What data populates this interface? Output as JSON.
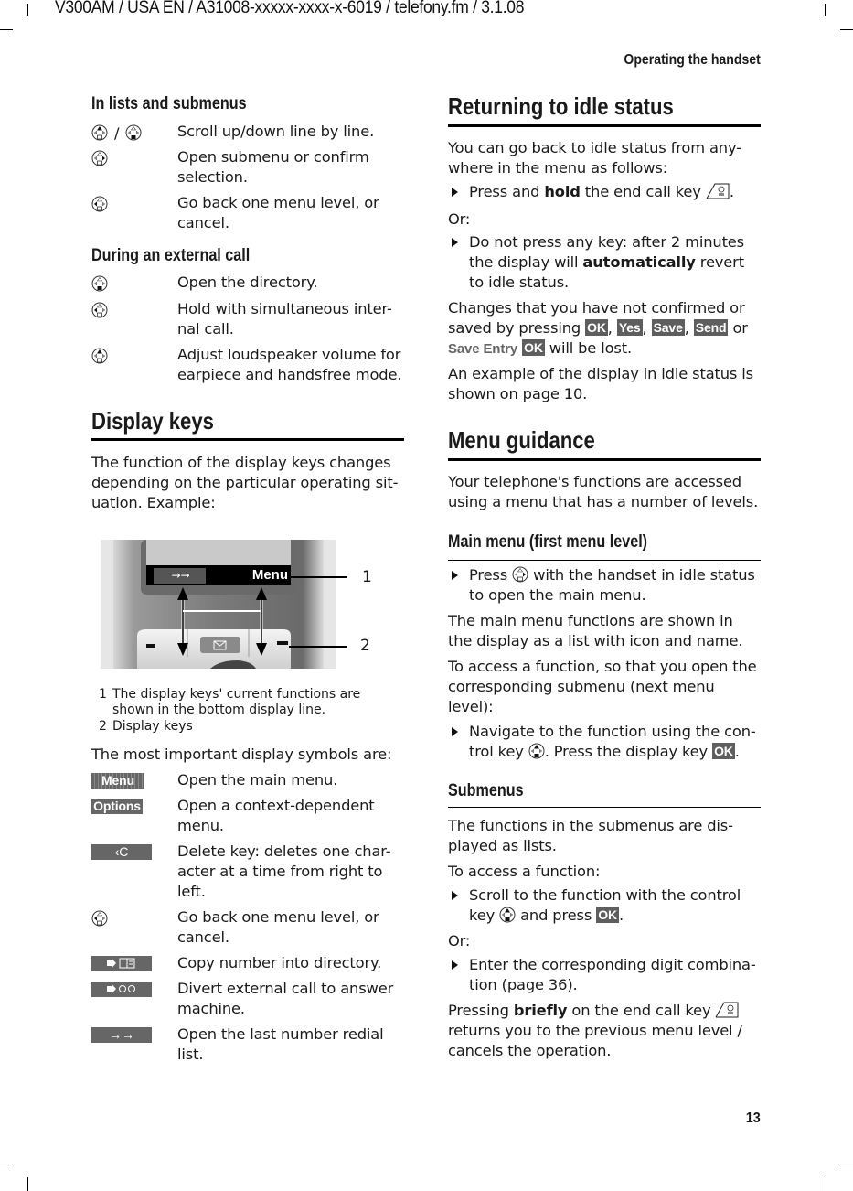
{
  "document": {
    "header_meta": "V300AM / USA EN / A31008-xxxxx-xxxx-x-6019 / telefony.fm / 3.1.08",
    "running_head": "Operating the handset",
    "page_number": "13"
  },
  "left": {
    "lists_heading": "In lists and submenus",
    "lists_items": [
      {
        "icons": [
          "control-key-up",
          "control-key-down"
        ],
        "separator": "/",
        "text": "Scroll up/down line by line."
      },
      {
        "icons": [
          "control-key-right"
        ],
        "text": "Open submenu or confirm selection."
      },
      {
        "icons": [
          "control-key-left"
        ],
        "text": "Go back one menu level, or cancel."
      }
    ],
    "external_heading": "During an external call",
    "external_items": [
      {
        "icons": [
          "control-key-down"
        ],
        "text": "Open the directory."
      },
      {
        "icons": [
          "control-key-left"
        ],
        "text": "Hold with simultaneous inter-nal call."
      },
      {
        "icons": [
          "control-key-up"
        ],
        "text": "Adjust loudspeaker volume for earpiece and handsfree mode."
      }
    ],
    "display_keys_heading": "Display keys",
    "display_keys_intro": "The function of the display keys changes depending on the particular operating sit-uation. Example:",
    "figure": {
      "left_softkey": "→→",
      "right_softkey": "Menu",
      "callouts": [
        "1",
        "2"
      ],
      "captions": [
        {
          "num": "1",
          "text": "The display keys' current functions are shown in the bottom display line."
        },
        {
          "num": "2",
          "text": "Display keys"
        }
      ]
    },
    "symbols_intro": "The most important display symbols are:",
    "symbols": [
      {
        "symbol": "Menu",
        "icon": "menu-softkey",
        "text": "Open the main menu."
      },
      {
        "symbol": "Options",
        "icon": "options-softkey",
        "text": "Open a context-dependent menu."
      },
      {
        "symbol": "‹C",
        "icon": "delete-softkey",
        "text": "Delete key: deletes one char-acter at a time from right to left."
      },
      {
        "symbol": "",
        "icon": "control-key-left",
        "text": "Go back one menu level, or cancel."
      },
      {
        "symbol": "➜📖",
        "icon": "copy-to-directory-softkey",
        "text": "Copy number into directory."
      },
      {
        "symbol": "➜QO",
        "icon": "divert-to-answer-machine-softkey",
        "text": "Divert external call to answer machine."
      },
      {
        "symbol": "→→",
        "icon": "redial-softkey",
        "text": "Open the last number redial list."
      }
    ]
  },
  "right": {
    "idle_heading": "Returning to idle status",
    "idle_intro": "You can go back to idle status from any-where in the menu as follows:",
    "idle_bullet1": {
      "pre": "Press and ",
      "bold": "hold",
      "post": " the end call key ",
      "end": "."
    },
    "or_label": "Or:",
    "idle_bullet2": {
      "pre": "Do not press any key: after 2 minutes the display will ",
      "bold": "automatically",
      "post": " revert to idle status."
    },
    "changes": {
      "pre": "Changes that you have not confirmed or saved by pressing ",
      "keys": [
        "OK",
        "Yes",
        "Save",
        "Send"
      ],
      "or": " or ",
      "menu_entry": "Save Entry",
      "last_key": "OK",
      "post": " will be lost."
    },
    "idle_example": "An example of the display in idle status is shown on page 10.",
    "menu_heading": "Menu guidance",
    "menu_intro": "Your telephone's functions are accessed using a menu that has a number of levels.",
    "main_menu_heading": "Main menu (first menu level)",
    "main_bullet": {
      "pre": "Press ",
      "post": " with the handset in idle status to open the main menu."
    },
    "main_para1": "The main menu functions are shown in the display as a list with icon and name.",
    "main_para2": "To access a function, so that you open the corresponding submenu (next menu level):",
    "main_bullet2": {
      "pre": "Navigate to the function using the con-trol key ",
      "mid": ". Press the display key ",
      "key": "OK",
      "end": "."
    },
    "submenus_heading": "Submenus",
    "sub_para1": "The functions in the submenus are dis-played as lists.",
    "sub_para2": "To access a function:",
    "sub_bullet1": {
      "pre": "Scroll to the function with the control key ",
      "mid": " and press ",
      "key": "OK",
      "end": "."
    },
    "sub_bullet2": "Enter the corresponding digit combina-tion (page 36).",
    "sub_final": {
      "pre": "Pressing ",
      "bold": "briefly",
      "post": " on the end call key ",
      "post2": " returns you to the previous menu level / cancels the operation."
    }
  }
}
